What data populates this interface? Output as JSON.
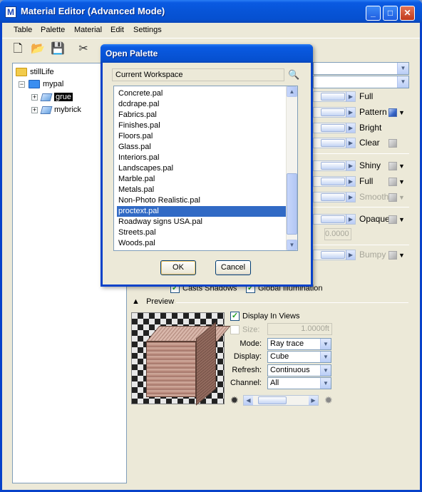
{
  "window": {
    "title": "Material Editor (Advanced Mode)"
  },
  "menubar": {
    "items": [
      "Table",
      "Palette",
      "Material",
      "Edit",
      "Settings"
    ]
  },
  "tree": {
    "root": "stillLife",
    "child": "mypal",
    "materials": [
      "grue",
      "mybrick"
    ]
  },
  "properties": {
    "rows": [
      {
        "label": "Full",
        "disabled": false,
        "cube": "none"
      },
      {
        "label": "Pattern",
        "disabled": false,
        "cube": "blue"
      },
      {
        "label": "Bright",
        "disabled": false,
        "cube": "none"
      },
      {
        "label": "Clear",
        "disabled": false,
        "cube": "gray"
      },
      {
        "label": "Shiny",
        "disabled": false,
        "cube": "gray"
      },
      {
        "label": "Full",
        "disabled": false,
        "cube": "gray"
      },
      {
        "label": "Smooth",
        "disabled": true,
        "cube": "gray"
      },
      {
        "label": "Opaque",
        "disabled": false,
        "cube": "gray"
      },
      {
        "label": "Bumpy",
        "disabled": true,
        "cube": "gray"
      }
    ],
    "translucency_value": "0.0000",
    "casts_shadows": "Casts Shadows",
    "global_illumination": "Global Illumination"
  },
  "preview": {
    "header": "Preview",
    "display_in_views": "Display In Views",
    "size_label": "Size:",
    "size_value": "1.0000ft",
    "mode_label": "Mode:",
    "mode_value": "Ray trace",
    "display_label": "Display:",
    "display_value": "Cube",
    "refresh_label": "Refresh:",
    "refresh_value": "Continuous",
    "channel_label": "Channel:",
    "channel_value": "All"
  },
  "dialog": {
    "title": "Open Palette",
    "path": "Current Workspace",
    "files": [
      "Concrete.pal",
      "dcdrape.pal",
      "Fabrics.pal",
      "Finishes.pal",
      "Floors.pal",
      "Glass.pal",
      "Interiors.pal",
      "Landscapes.pal",
      "Marble.pal",
      "Metals.pal",
      "Non-Photo Realistic.pal",
      "proctext.pal",
      "Roadway signs USA.pal",
      "Streets.pal",
      "Woods.pal"
    ],
    "selected_index": 11,
    "scroll_position": 0.62,
    "ok_label": "OK",
    "cancel_label": "Cancel"
  },
  "colors": {
    "title_blue": "#0754d7",
    "selection_blue": "#316ac5",
    "window_bg": "#ece9d8"
  }
}
